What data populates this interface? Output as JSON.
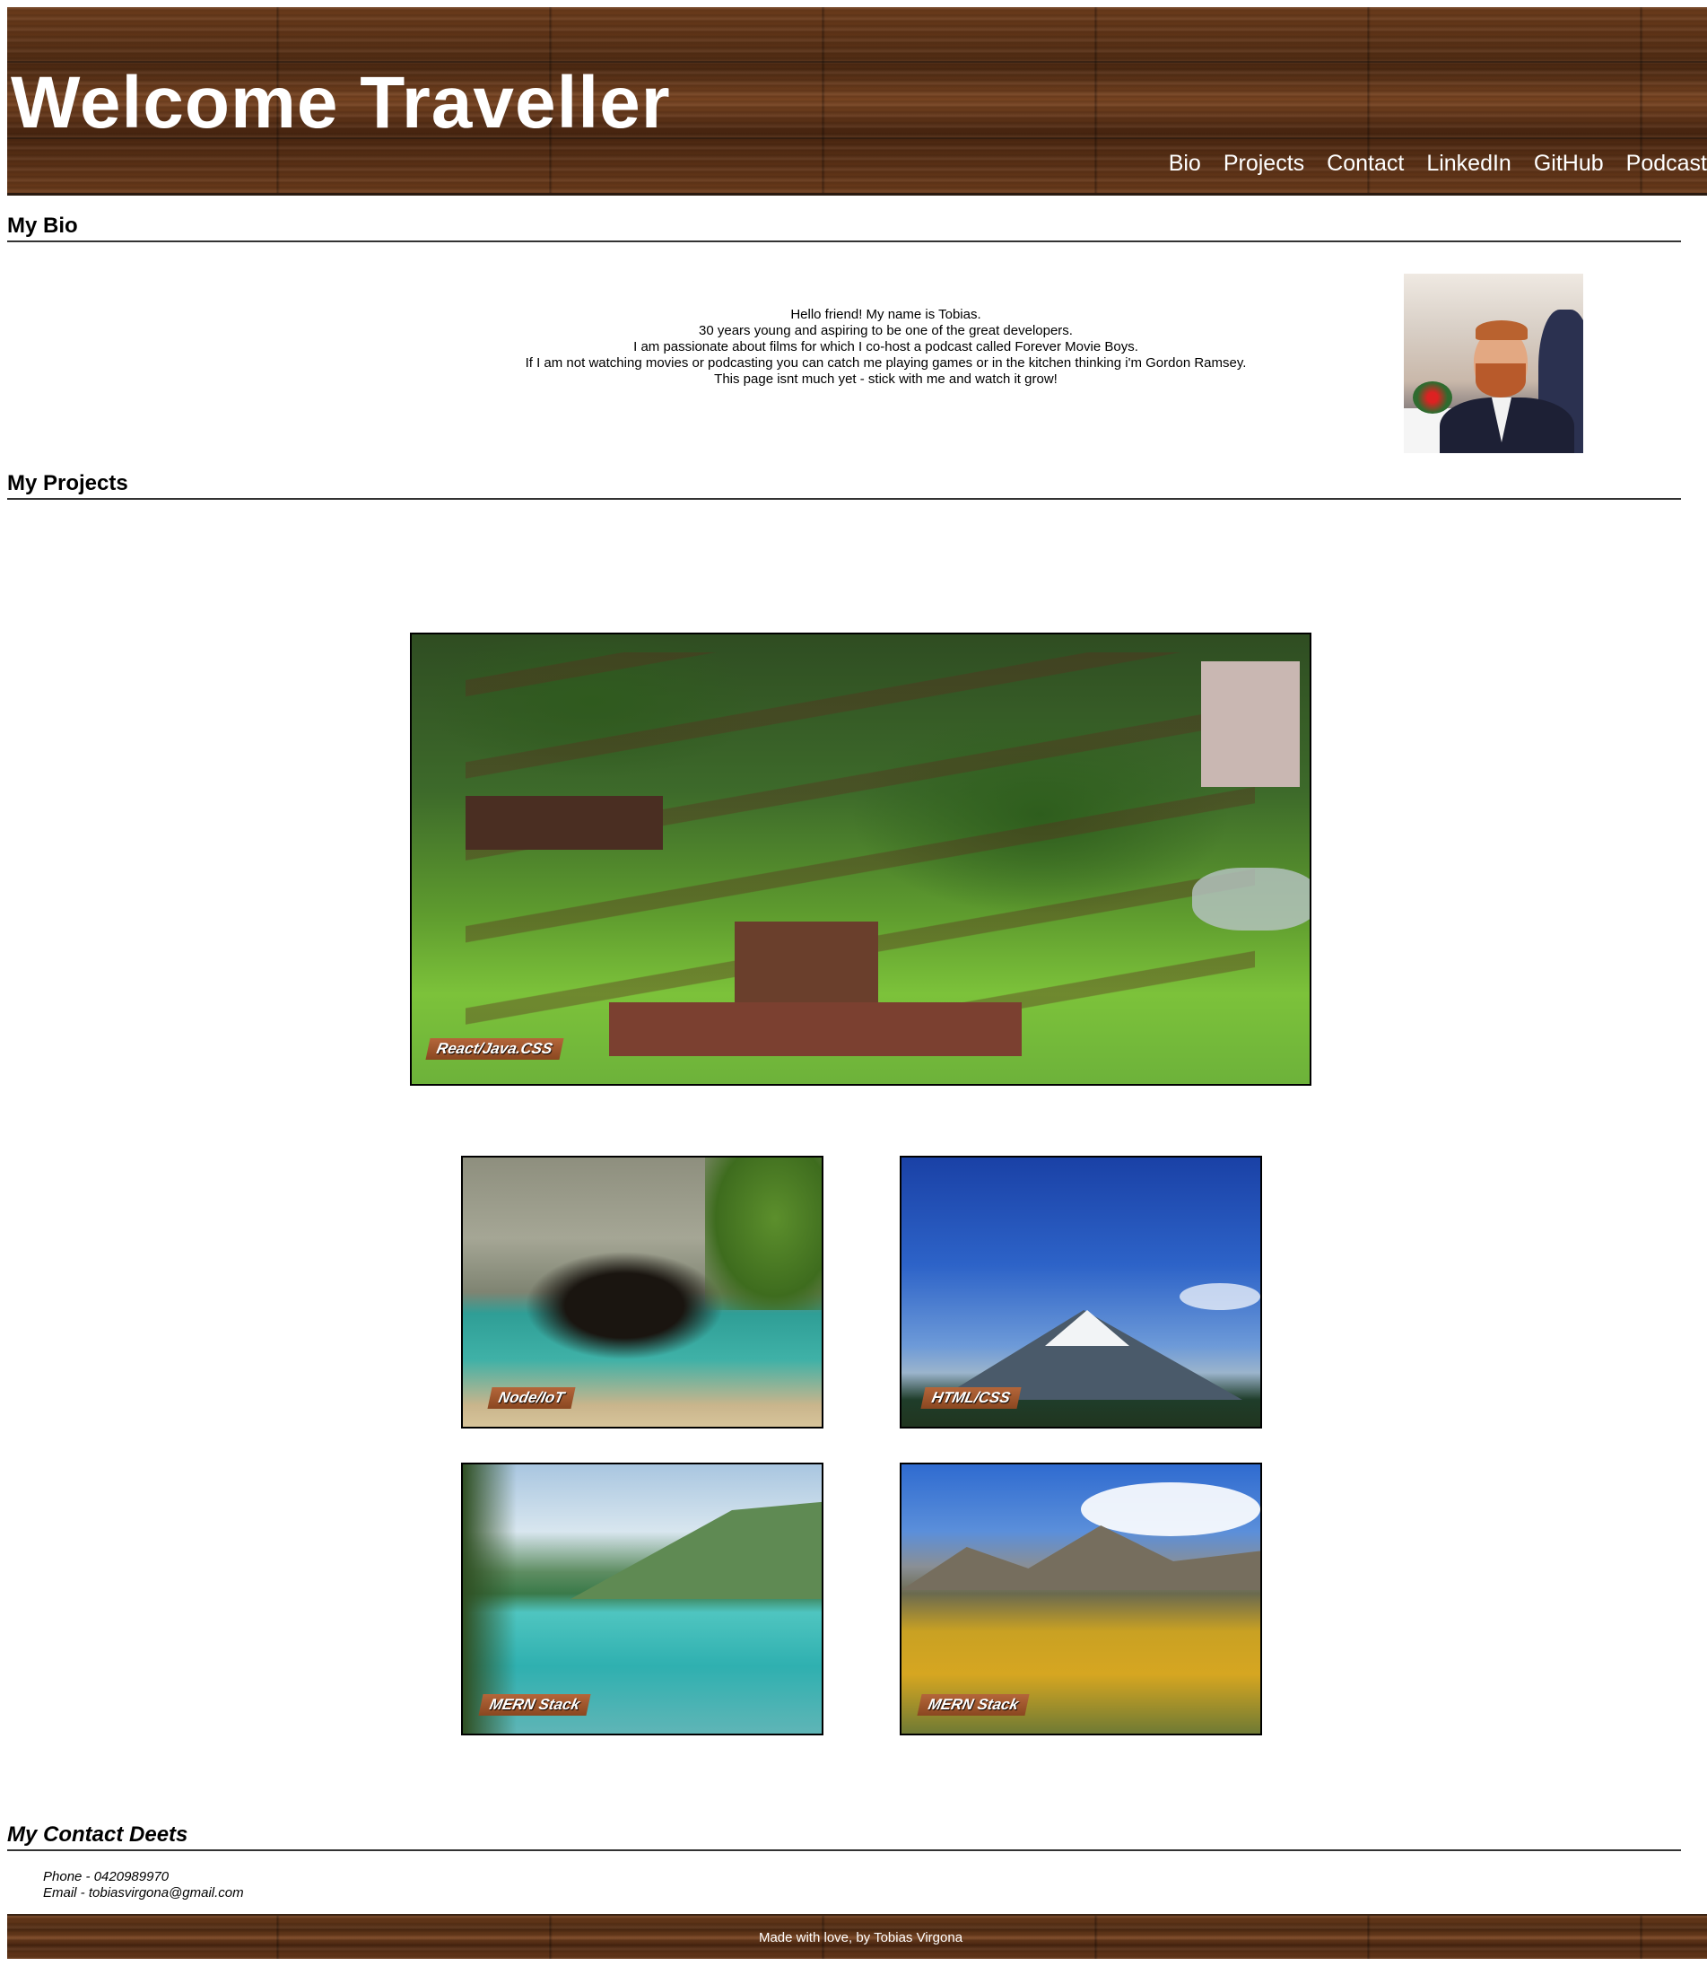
{
  "header": {
    "title": "Welcome Traveller",
    "nav": [
      "Bio",
      "Projects",
      "Contact",
      "LinkedIn",
      "GitHub",
      "Podcast"
    ]
  },
  "bio": {
    "heading": "My Bio",
    "lines": [
      "Hello friend! My name is Tobias.",
      "30 years young and aspiring to be one of the great developers.",
      "I am passionate about films for which I co-host a podcast called Forever Movie Boys.",
      "If I am not watching movies or podcasting you can catch me playing games or in the kitchen thinking i'm Gordon Ramsey.",
      "This page isnt much yet - stick with me and watch it grow!"
    ]
  },
  "projects": {
    "heading": "My Projects",
    "items": [
      {
        "tag": "React/Java.CSS"
      },
      {
        "tag": "Node/IoT"
      },
      {
        "tag": "HTML/CSS"
      },
      {
        "tag": "MERN Stack"
      },
      {
        "tag": "MERN Stack"
      }
    ]
  },
  "contact": {
    "heading": "My Contact Deets",
    "phone": "Phone - 0420989970",
    "email": "Email - tobiasvirgona@gmail.com"
  },
  "footer": {
    "text": "Made with love, by Tobias Virgona"
  }
}
